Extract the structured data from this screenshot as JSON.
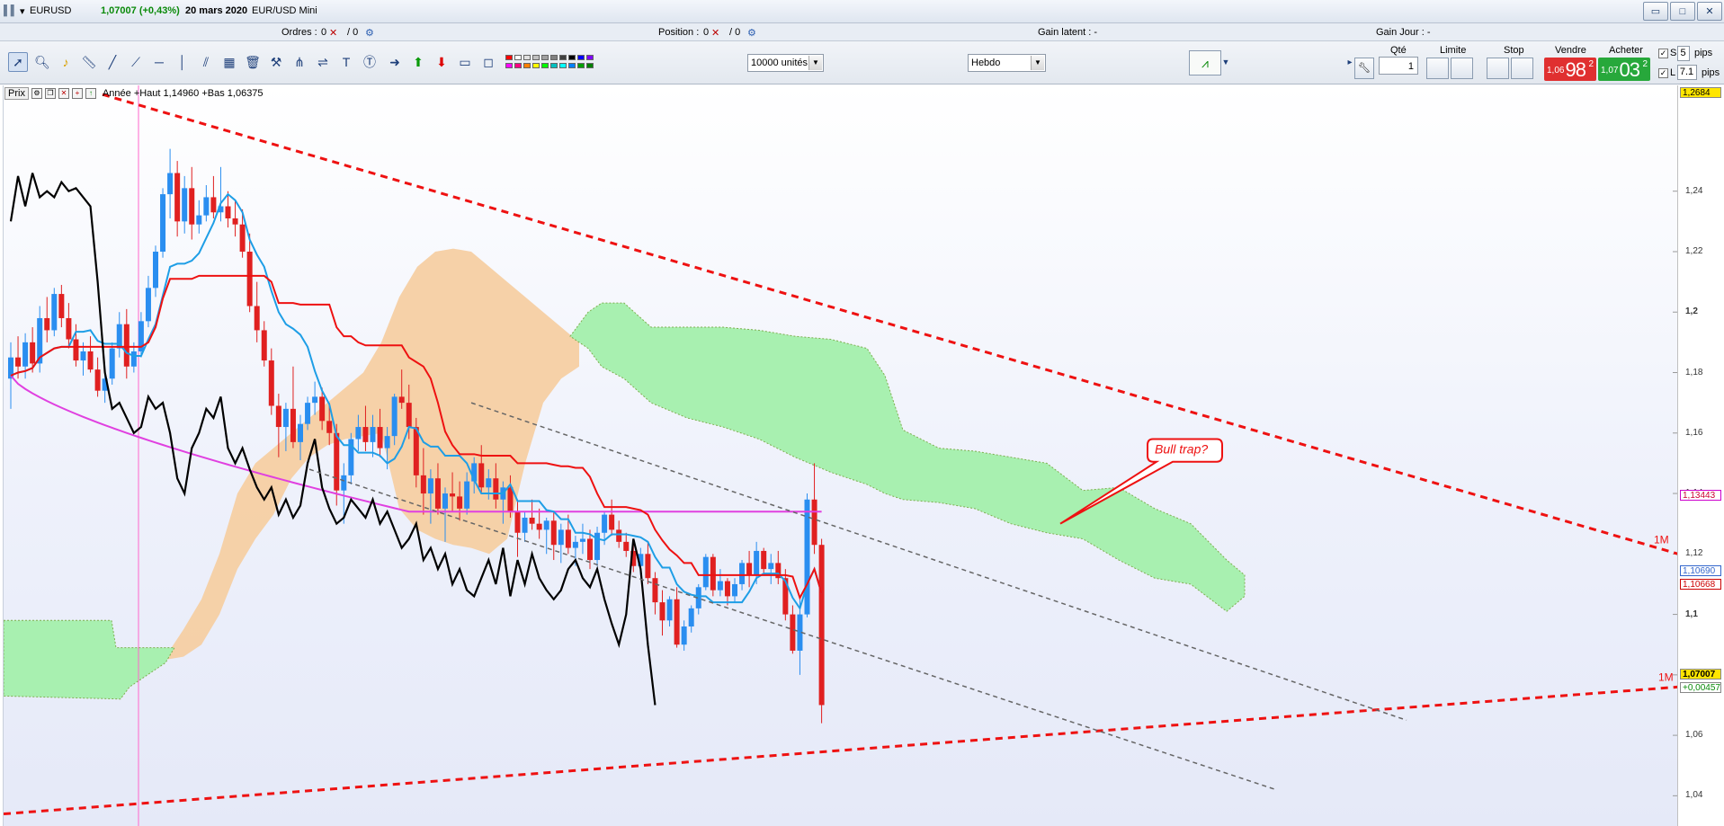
{
  "titlebar": {
    "symbol": "EURUSD",
    "quote": "1,07007 (+0,43%)",
    "date": "20 mars 2020",
    "instrument": "EUR/USD Mini",
    "buttons": [
      "▭",
      "□",
      "✕"
    ]
  },
  "infobar": {
    "orders_label": "Ordres :",
    "orders_value": "0",
    "orders_total": "/ 0",
    "position_label": "Position :",
    "position_value": "0",
    "position_total": "/ 0",
    "unrealized_label": "Gain latent : -",
    "daily_label": "Gain Jour : -"
  },
  "toolbar": {
    "units_select": "10000 unités",
    "period_select": "Hebdo",
    "colors": [
      "#ff0000",
      "#ffffff",
      "#e0e0e0",
      "#c0c0c0",
      "#a0a0a0",
      "#808080",
      "#404040",
      "#000000",
      "#0000ff",
      "#8000ff",
      "#ff00ff",
      "#ff0080",
      "#ff8000",
      "#ffff00",
      "#00ff00",
      "#00c0c0",
      "#00ffff",
      "#0080ff",
      "#00a000",
      "#008000"
    ]
  },
  "trade": {
    "qty_label": "Qté",
    "qty_value": "1",
    "limit_label": "Limite",
    "stop_label": "Stop",
    "sell_label": "Vendre",
    "sell_small": "1,06",
    "sell_big": "98",
    "sell_sup": "2",
    "buy_label": "Acheter",
    "buy_small": "1,07",
    "buy_big": "03",
    "buy_sup": "2",
    "s_label": "S",
    "s_pips": "5",
    "l_label": "L",
    "l_pips": "7.1",
    "pips_label": "pips"
  },
  "chart_header": {
    "price_label": "Prix",
    "info": "Année +Haut 1,14960 +Bas 1,06375"
  },
  "chart_data": {
    "type": "candlestick",
    "instrument": "EURUSD",
    "timeframe": "Hebdo",
    "ylim": [
      1.03,
      1.275
    ],
    "yticks": [
      "1,24",
      "1,22",
      "1,2",
      "1,18",
      "1,16",
      "1,14",
      "1,12",
      "1,1",
      "1,08",
      "1,06",
      "1,04"
    ],
    "annotation": "Bull trap?",
    "line_labels": [
      "1M",
      "1M"
    ],
    "candles": [
      [
        1.178,
        1.19,
        1.168,
        1.185
      ],
      [
        1.185,
        1.192,
        1.178,
        1.182
      ],
      [
        1.182,
        1.193,
        1.178,
        1.19
      ],
      [
        1.19,
        1.195,
        1.18,
        1.183
      ],
      [
        1.183,
        1.202,
        1.18,
        1.198
      ],
      [
        1.198,
        1.205,
        1.19,
        1.194
      ],
      [
        1.194,
        1.208,
        1.192,
        1.206
      ],
      [
        1.206,
        1.209,
        1.195,
        1.198
      ],
      [
        1.198,
        1.203,
        1.188,
        1.191
      ],
      [
        1.191,
        1.196,
        1.182,
        1.184
      ],
      [
        1.184,
        1.19,
        1.179,
        1.187
      ],
      [
        1.187,
        1.192,
        1.18,
        1.181
      ],
      [
        1.181,
        1.185,
        1.172,
        1.174
      ],
      [
        1.174,
        1.18,
        1.17,
        1.178
      ],
      [
        1.178,
        1.19,
        1.176,
        1.188
      ],
      [
        1.188,
        1.2,
        1.185,
        1.196
      ],
      [
        1.196,
        1.201,
        1.178,
        1.182
      ],
      [
        1.182,
        1.19,
        1.18,
        1.187
      ],
      [
        1.187,
        1.2,
        1.185,
        1.197
      ],
      [
        1.197,
        1.212,
        1.195,
        1.208
      ],
      [
        1.208,
        1.222,
        1.205,
        1.22
      ],
      [
        1.22,
        1.241,
        1.218,
        1.239
      ],
      [
        1.239,
        1.254,
        1.231,
        1.246
      ],
      [
        1.246,
        1.25,
        1.225,
        1.23
      ],
      [
        1.23,
        1.245,
        1.226,
        1.241
      ],
      [
        1.241,
        1.248,
        1.224,
        1.229
      ],
      [
        1.229,
        1.237,
        1.226,
        1.232
      ],
      [
        1.232,
        1.242,
        1.23,
        1.238
      ],
      [
        1.238,
        1.245,
        1.231,
        1.233
      ],
      [
        1.233,
        1.248,
        1.23,
        1.235
      ],
      [
        1.235,
        1.24,
        1.228,
        1.231
      ],
      [
        1.231,
        1.237,
        1.225,
        1.229
      ],
      [
        1.229,
        1.234,
        1.218,
        1.22
      ],
      [
        1.22,
        1.226,
        1.2,
        1.202
      ],
      [
        1.202,
        1.21,
        1.19,
        1.194
      ],
      [
        1.194,
        1.197,
        1.182,
        1.184
      ],
      [
        1.184,
        1.188,
        1.166,
        1.169
      ],
      [
        1.169,
        1.173,
        1.152,
        1.162
      ],
      [
        1.162,
        1.17,
        1.154,
        1.168
      ],
      [
        1.168,
        1.182,
        1.155,
        1.157
      ],
      [
        1.157,
        1.166,
        1.151,
        1.163
      ],
      [
        1.163,
        1.172,
        1.161,
        1.17
      ],
      [
        1.17,
        1.177,
        1.166,
        1.172
      ],
      [
        1.172,
        1.175,
        1.161,
        1.164
      ],
      [
        1.164,
        1.17,
        1.156,
        1.16
      ],
      [
        1.16,
        1.163,
        1.136,
        1.141
      ],
      [
        1.141,
        1.15,
        1.13,
        1.146
      ],
      [
        1.146,
        1.16,
        1.143,
        1.158
      ],
      [
        1.158,
        1.166,
        1.154,
        1.162
      ],
      [
        1.162,
        1.169,
        1.154,
        1.157
      ],
      [
        1.157,
        1.166,
        1.152,
        1.162
      ],
      [
        1.162,
        1.168,
        1.152,
        1.155
      ],
      [
        1.155,
        1.162,
        1.148,
        1.159
      ],
      [
        1.159,
        1.173,
        1.156,
        1.172
      ],
      [
        1.172,
        1.181,
        1.168,
        1.17
      ],
      [
        1.17,
        1.176,
        1.158,
        1.162
      ],
      [
        1.162,
        1.165,
        1.142,
        1.146
      ],
      [
        1.146,
        1.155,
        1.133,
        1.14
      ],
      [
        1.14,
        1.148,
        1.13,
        1.145
      ],
      [
        1.145,
        1.15,
        1.133,
        1.135
      ],
      [
        1.135,
        1.142,
        1.124,
        1.14
      ],
      [
        1.14,
        1.147,
        1.134,
        1.139
      ],
      [
        1.139,
        1.144,
        1.131,
        1.135
      ],
      [
        1.135,
        1.147,
        1.133,
        1.144
      ],
      [
        1.144,
        1.152,
        1.14,
        1.15
      ],
      [
        1.15,
        1.156,
        1.14,
        1.142
      ],
      [
        1.142,
        1.148,
        1.138,
        1.145
      ],
      [
        1.145,
        1.15,
        1.135,
        1.138
      ],
      [
        1.138,
        1.144,
        1.13,
        1.142
      ],
      [
        1.142,
        1.146,
        1.132,
        1.134
      ],
      [
        1.134,
        1.138,
        1.119,
        1.127
      ],
      [
        1.127,
        1.134,
        1.124,
        1.132
      ],
      [
        1.132,
        1.138,
        1.128,
        1.13
      ],
      [
        1.13,
        1.135,
        1.125,
        1.128
      ],
      [
        1.128,
        1.132,
        1.12,
        1.131
      ],
      [
        1.131,
        1.134,
        1.118,
        1.123
      ],
      [
        1.123,
        1.13,
        1.117,
        1.128
      ],
      [
        1.128,
        1.133,
        1.12,
        1.122
      ],
      [
        1.122,
        1.126,
        1.116,
        1.124
      ],
      [
        1.124,
        1.13,
        1.12,
        1.125
      ],
      [
        1.125,
        1.128,
        1.115,
        1.118
      ],
      [
        1.118,
        1.129,
        1.116,
        1.127
      ],
      [
        1.127,
        1.134,
        1.123,
        1.133
      ],
      [
        1.133,
        1.138,
        1.126,
        1.128
      ],
      [
        1.128,
        1.131,
        1.122,
        1.124
      ],
      [
        1.124,
        1.127,
        1.119,
        1.121
      ],
      [
        1.121,
        1.125,
        1.114,
        1.116
      ],
      [
        1.116,
        1.122,
        1.113,
        1.12
      ],
      [
        1.12,
        1.124,
        1.11,
        1.112
      ],
      [
        1.112,
        1.114,
        1.1,
        1.104
      ],
      [
        1.104,
        1.108,
        1.093,
        1.098
      ],
      [
        1.098,
        1.106,
        1.096,
        1.105
      ],
      [
        1.105,
        1.109,
        1.089,
        1.09
      ],
      [
        1.09,
        1.098,
        1.088,
        1.096
      ],
      [
        1.096,
        1.103,
        1.094,
        1.102
      ],
      [
        1.102,
        1.11,
        1.1,
        1.109
      ],
      [
        1.109,
        1.12,
        1.108,
        1.119
      ],
      [
        1.119,
        1.12,
        1.106,
        1.108
      ],
      [
        1.108,
        1.115,
        1.106,
        1.111
      ],
      [
        1.111,
        1.112,
        1.103,
        1.106
      ],
      [
        1.106,
        1.112,
        1.104,
        1.11
      ],
      [
        1.11,
        1.118,
        1.108,
        1.117
      ],
      [
        1.117,
        1.121,
        1.109,
        1.113
      ],
      [
        1.113,
        1.124,
        1.11,
        1.121
      ],
      [
        1.121,
        1.122,
        1.113,
        1.115
      ],
      [
        1.115,
        1.12,
        1.11,
        1.117
      ],
      [
        1.117,
        1.121,
        1.11,
        1.112
      ],
      [
        1.112,
        1.115,
        1.098,
        1.1
      ],
      [
        1.1,
        1.103,
        1.087,
        1.088
      ],
      [
        1.088,
        1.105,
        1.08,
        1.1
      ],
      [
        1.1,
        1.14,
        1.099,
        1.138
      ],
      [
        1.138,
        1.15,
        1.12,
        1.123
      ],
      [
        1.123,
        1.125,
        1.064,
        1.07
      ]
    ],
    "series": [
      {
        "name": "black-line",
        "values": [
          1.23,
          1.245,
          1.235,
          1.246,
          1.238,
          1.24,
          1.238,
          1.243,
          1.24,
          1.241,
          1.238,
          1.235,
          1.21,
          1.18,
          1.168,
          1.17,
          1.165,
          1.16,
          1.162,
          1.172,
          1.168,
          1.17,
          1.16,
          1.145,
          1.14,
          1.155,
          1.16,
          1.168,
          1.165,
          1.172,
          1.155,
          1.15,
          1.155,
          1.148,
          1.142,
          1.138,
          1.142,
          1.133,
          1.138,
          1.132,
          1.136,
          1.15,
          1.158,
          1.142,
          1.135,
          1.13,
          1.132,
          1.138,
          1.135,
          1.132,
          1.138,
          1.13,
          1.134,
          1.128,
          1.122,
          1.125,
          1.13,
          1.118,
          1.122,
          1.115,
          1.12,
          1.11,
          1.115,
          1.108,
          1.106,
          1.112,
          1.118,
          1.11,
          1.122,
          1.106,
          1.118,
          1.11,
          1.12,
          1.112,
          1.108,
          1.105,
          1.108,
          1.115,
          1.118,
          1.112,
          1.109,
          1.115,
          1.105,
          1.097,
          1.09,
          1.1,
          1.125,
          1.115,
          1.09,
          1.07
        ]
      }
    ]
  }
}
